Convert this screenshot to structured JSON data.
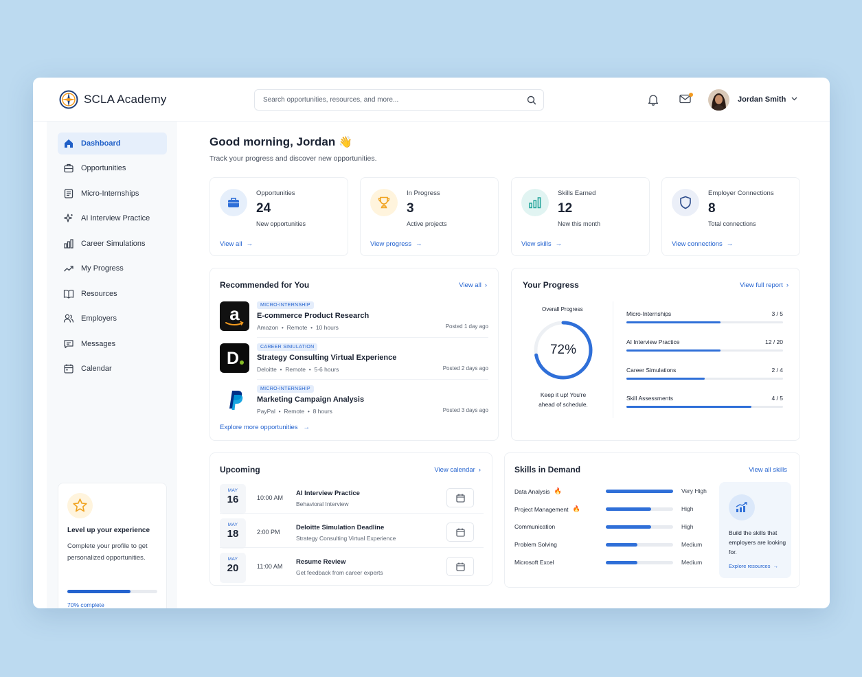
{
  "brand": {
    "name": "SCLA Academy"
  },
  "search": {
    "placeholder": "Search opportunities, resources, and more..."
  },
  "user": {
    "name": "Jordan Smith"
  },
  "sidebar": {
    "items": [
      {
        "label": "Dashboard",
        "icon": "home-icon",
        "active": true
      },
      {
        "label": "Opportunities",
        "icon": "briefcase-icon"
      },
      {
        "label": "Micro-Internships",
        "icon": "document-icon"
      },
      {
        "label": "AI Interview Practice",
        "icon": "sparkle-icon"
      },
      {
        "label": "Career Simulations",
        "icon": "bar-chart-icon"
      },
      {
        "label": "My Progress",
        "icon": "trend-icon"
      },
      {
        "label": "Resources",
        "icon": "book-icon"
      },
      {
        "label": "Employers",
        "icon": "users-icon"
      },
      {
        "label": "Messages",
        "icon": "message-icon"
      },
      {
        "label": "Calendar",
        "icon": "calendar-icon"
      }
    ],
    "promo": {
      "title": "Level up your experience",
      "description": "Complete your profile to get personalized opportunities.",
      "progress": 0.7,
      "progress_label": "70% complete"
    }
  },
  "greeting": {
    "title": "Good morning, Jordan",
    "emoji": "👋",
    "subtitle": "Track your progress and discover new opportunities."
  },
  "stats": [
    {
      "label": "Opportunities",
      "value": "24",
      "sub": "New opportunities",
      "link": "View all",
      "color": "#2f6fd8"
    },
    {
      "label": "In Progress",
      "value": "3",
      "sub": "Active projects",
      "link": "View progress",
      "color": "#f3a51e"
    },
    {
      "label": "Skills Earned",
      "value": "12",
      "sub": "New this month",
      "link": "View skills",
      "color": "#22a39a"
    },
    {
      "label": "Employer Connections",
      "value": "8",
      "sub": "Total connections",
      "link": "View connections",
      "color": "#2f6fd8"
    }
  ],
  "recommended": {
    "title": "Recommended for You",
    "view_all": "View all",
    "items": [
      {
        "tag": "MICRO-INTERNSHIP",
        "title": "E-commerce Product Research",
        "company": "Amazon",
        "mode": "Remote",
        "duration": "10 hours",
        "posted": "Posted 1 day ago"
      },
      {
        "tag": "CAREER SIMULATION",
        "title": "Strategy Consulting Virtual Experience",
        "company": "Deloitte",
        "mode": "Remote",
        "duration": "5-6 hours",
        "posted": "Posted 2 days ago"
      },
      {
        "tag": "MICRO-INTERNSHIP",
        "title": "Marketing Campaign Analysis",
        "company": "PayPal",
        "mode": "Remote",
        "duration": "8 hours",
        "posted": "Posted 3 days ago"
      }
    ],
    "explore": "Explore more opportunities"
  },
  "progress": {
    "title": "Your Progress",
    "link": "View full report",
    "overall_label": "Overall Progress",
    "overall_value": 72,
    "overall_text": "72%",
    "message": "Keep it up! You're ahead of schedule.",
    "rows": [
      {
        "name": "Micro-Internships",
        "count": "3 / 5",
        "fraction": 0.6
      },
      {
        "name": "AI Interview Practice",
        "count": "12 / 20",
        "fraction": 0.6
      },
      {
        "name": "Career Simulations",
        "count": "2 / 4",
        "fraction": 0.5
      },
      {
        "name": "Skill Assessments",
        "count": "4 / 5",
        "fraction": 0.8
      }
    ]
  },
  "upcoming": {
    "title": "Upcoming",
    "link": "View calendar",
    "events": [
      {
        "month": "MAY",
        "day": "16",
        "time": "10:00 AM",
        "title": "AI Interview Practice",
        "sub": "Behavioral Interview"
      },
      {
        "month": "MAY",
        "day": "18",
        "time": "2:00 PM",
        "title": "Deloitte Simulation Deadline",
        "sub": "Strategy Consulting Virtual Experience"
      },
      {
        "month": "MAY",
        "day": "20",
        "time": "11:00 AM",
        "title": "Resume Review",
        "sub": "Get feedback from career experts"
      }
    ]
  },
  "skills": {
    "title": "Skills in Demand",
    "link": "View all skills",
    "items": [
      {
        "name": "Data Analysis",
        "hot": true,
        "level": "Very High",
        "fraction": 1.0
      },
      {
        "name": "Project Management",
        "hot": true,
        "level": "High",
        "fraction": 0.67
      },
      {
        "name": "Communication",
        "hot": false,
        "level": "High",
        "fraction": 0.67
      },
      {
        "name": "Problem Solving",
        "hot": false,
        "level": "Medium",
        "fraction": 0.47
      },
      {
        "name": "Microsoft Excel",
        "hot": false,
        "level": "Medium",
        "fraction": 0.47
      }
    ],
    "promo_text": "Build the skills that employers are looking for.",
    "promo_link": "Explore resources",
    "hot_symbol": "🔥"
  }
}
